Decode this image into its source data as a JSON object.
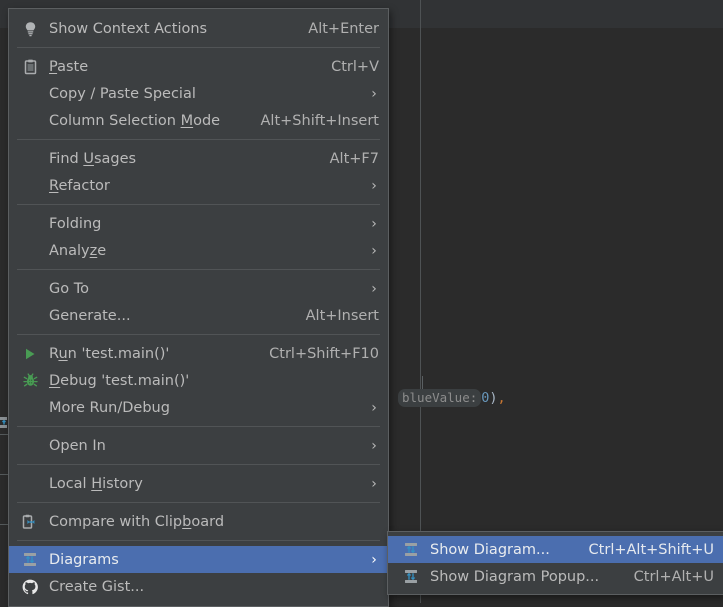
{
  "app": {
    "theme": "darcula",
    "colors": {
      "menu_background": "#3c3f41",
      "menu_border": "#5c5f61",
      "menu_text": "#bbbbbb",
      "selection_blue": "#4b6eaf",
      "editor_background": "#2b2b2b",
      "editor_band": "#313335",
      "run_green": "#499c54",
      "icon_blue": "#3592c4",
      "number_blue": "#6897bb",
      "comma_orange": "#cc7832",
      "hint_grey": "#8c8c8c"
    }
  },
  "editor": {
    "code_line": {
      "hint_label": "blueValue:",
      "value": "0",
      "close_paren": ")",
      "comma": ","
    }
  },
  "context_menu": {
    "groups": [
      {
        "items": [
          {
            "label": "Show Context Actions",
            "label_before": "Show Context Actions",
            "mnemonic": "",
            "label_after": "",
            "shortcut": "Alt+Enter",
            "icon": "lightbulb-icon",
            "submenu": false,
            "selected": false
          }
        ]
      },
      {
        "items": [
          {
            "label": "Paste",
            "label_before": "",
            "mnemonic": "P",
            "label_after": "aste",
            "shortcut": "Ctrl+V",
            "icon": "clipboard-icon",
            "submenu": false,
            "selected": false
          },
          {
            "label": "Copy / Paste Special",
            "label_before": "Copy / Paste Special",
            "mnemonic": "",
            "label_after": "",
            "shortcut": "",
            "icon": "none",
            "submenu": true,
            "selected": false
          },
          {
            "label": "Column Selection Mode",
            "label_before": "Column Selection ",
            "mnemonic": "M",
            "label_after": "ode",
            "shortcut": "Alt+Shift+Insert",
            "icon": "none",
            "submenu": false,
            "selected": false
          }
        ]
      },
      {
        "items": [
          {
            "label": "Find Usages",
            "label_before": "Find ",
            "mnemonic": "U",
            "label_after": "sages",
            "shortcut": "Alt+F7",
            "icon": "none",
            "submenu": false,
            "selected": false
          },
          {
            "label": "Refactor",
            "label_before": "",
            "mnemonic": "R",
            "label_after": "efactor",
            "shortcut": "",
            "icon": "none",
            "submenu": true,
            "selected": false
          }
        ]
      },
      {
        "items": [
          {
            "label": "Folding",
            "label_before": "Folding",
            "mnemonic": "",
            "label_after": "",
            "shortcut": "",
            "icon": "none",
            "submenu": true,
            "selected": false
          },
          {
            "label": "Analyze",
            "label_before": "Analy",
            "mnemonic": "z",
            "label_after": "e",
            "shortcut": "",
            "icon": "none",
            "submenu": true,
            "selected": false
          }
        ]
      },
      {
        "items": [
          {
            "label": "Go To",
            "label_before": "Go To",
            "mnemonic": "",
            "label_after": "",
            "shortcut": "",
            "icon": "none",
            "submenu": true,
            "selected": false
          },
          {
            "label": "Generate...",
            "label_before": "Generate...",
            "mnemonic": "",
            "label_after": "",
            "shortcut": "Alt+Insert",
            "icon": "none",
            "submenu": false,
            "selected": false
          }
        ]
      },
      {
        "items": [
          {
            "label": "Run 'test.main()'",
            "label_before": "R",
            "mnemonic": "u",
            "label_after": "n 'test.main()'",
            "shortcut": "Ctrl+Shift+F10",
            "icon": "run-icon",
            "submenu": false,
            "selected": false
          },
          {
            "label": "Debug 'test.main()'",
            "label_before": "",
            "mnemonic": "D",
            "label_after": "ebug 'test.main()'",
            "shortcut": "",
            "icon": "debug-icon",
            "submenu": false,
            "selected": false
          },
          {
            "label": "More Run/Debug",
            "label_before": "More Run/Debug",
            "mnemonic": "",
            "label_after": "",
            "shortcut": "",
            "icon": "none",
            "submenu": true,
            "selected": false
          }
        ]
      },
      {
        "items": [
          {
            "label": "Open In",
            "label_before": "Open In",
            "mnemonic": "",
            "label_after": "",
            "shortcut": "",
            "icon": "none",
            "submenu": true,
            "selected": false
          }
        ]
      },
      {
        "items": [
          {
            "label": "Local History",
            "label_before": "Local ",
            "mnemonic": "H",
            "label_after": "istory",
            "shortcut": "",
            "icon": "none",
            "submenu": true,
            "selected": false
          }
        ]
      },
      {
        "items": [
          {
            "label": "Compare with Clipboard",
            "label_before": "Compare with Clip",
            "mnemonic": "b",
            "label_after": "oard",
            "shortcut": "",
            "icon": "compare-clipboard-icon",
            "submenu": false,
            "selected": false
          }
        ]
      },
      {
        "items": [
          {
            "label": "Diagrams",
            "label_before": "Diagrams",
            "mnemonic": "",
            "label_after": "",
            "shortcut": "",
            "icon": "diagram-icon",
            "submenu": true,
            "selected": true
          },
          {
            "label": "Create Gist...",
            "label_before": "Create Gist...",
            "mnemonic": "",
            "label_after": "",
            "shortcut": "",
            "icon": "github-icon",
            "submenu": false,
            "selected": false
          }
        ]
      }
    ]
  },
  "submenu": {
    "title": "Diagrams",
    "items": [
      {
        "label": "Show Diagram...",
        "shortcut": "Ctrl+Alt+Shift+U",
        "icon": "diagram-icon",
        "selected": true
      },
      {
        "label": "Show Diagram Popup...",
        "shortcut": "Ctrl+Alt+U",
        "icon": "diagram-icon",
        "selected": false
      }
    ]
  }
}
